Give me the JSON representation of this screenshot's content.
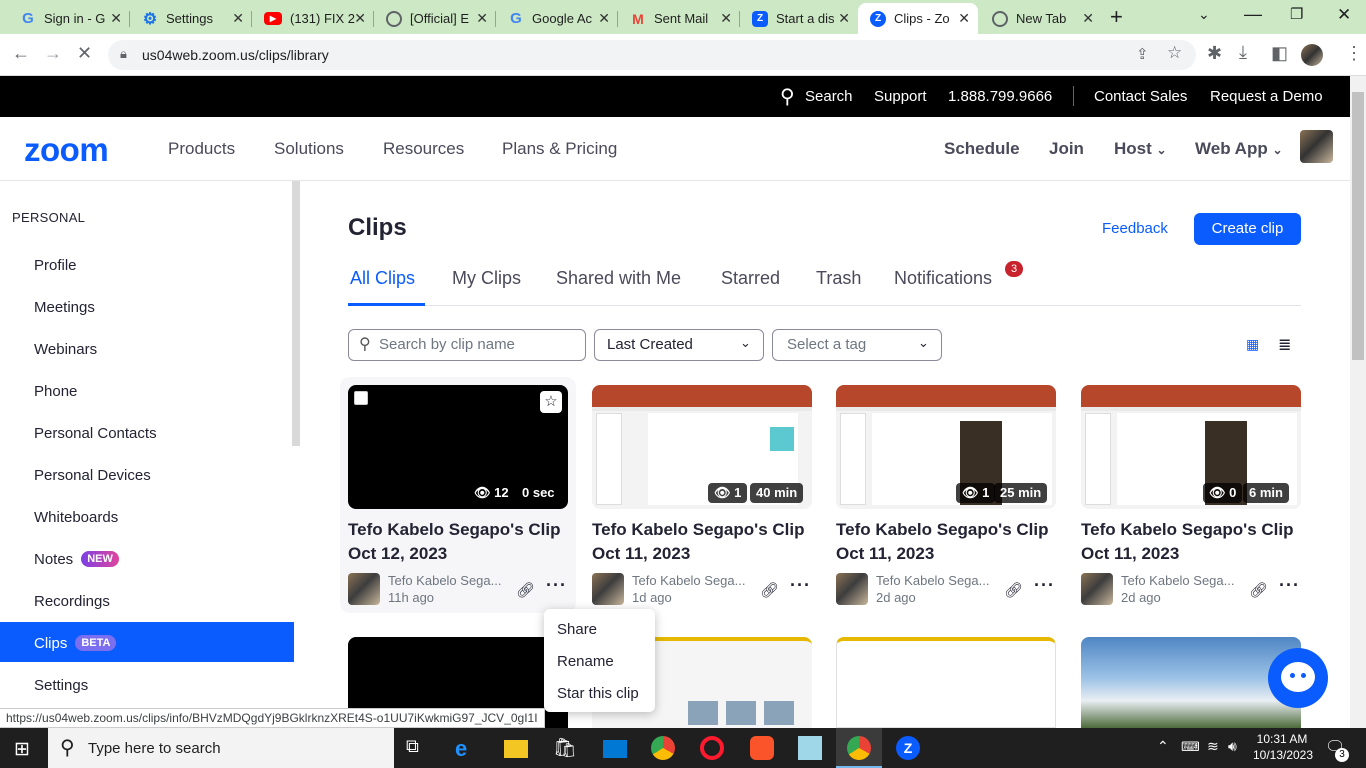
{
  "browser": {
    "tabs": [
      {
        "title": "Sign in - G",
        "icon": "google-icon",
        "color": "#4285f4"
      },
      {
        "title": "Settings",
        "icon": "gear-icon",
        "color": "#1a73e8"
      },
      {
        "title": "(131) FIX 2",
        "icon": "youtube-icon",
        "color": "#ff0000"
      },
      {
        "title": "[Official] E",
        "icon": "globe-icon",
        "color": "#5f6368"
      },
      {
        "title": "Google Ac",
        "icon": "google-icon",
        "color": "#4285f4"
      },
      {
        "title": "Sent Mail",
        "icon": "gmail-icon",
        "color": "#ea4335"
      },
      {
        "title": "Start a dis",
        "icon": "zoom-icon",
        "color": "#0b5cff"
      },
      {
        "title": "Clips - Zo",
        "icon": "zoom-clips-icon",
        "color": "#0b5cff"
      },
      {
        "title": "New Tab",
        "icon": "chrome-icon",
        "color": "#5f6368"
      }
    ],
    "url": "us04web.zoom.us/clips/library",
    "status_url": "https://us04web.zoom.us/clips/info/BHVzMDQgdYj9BGklrknzXREt4S-o1UU7iKwkmiG97_JCV_0gI1I"
  },
  "topbar": {
    "search": "Search",
    "support": "Support",
    "phone": "1.888.799.9666",
    "contact_sales": "Contact Sales",
    "request_demo": "Request a Demo"
  },
  "nav": {
    "logo": "zoom",
    "products": "Products",
    "solutions": "Solutions",
    "resources": "Resources",
    "plans": "Plans & Pricing",
    "schedule": "Schedule",
    "join": "Join",
    "host": "Host",
    "webapp": "Web App"
  },
  "sidebar": {
    "header": "PERSONAL",
    "items": [
      {
        "label": "Profile"
      },
      {
        "label": "Meetings"
      },
      {
        "label": "Webinars"
      },
      {
        "label": "Phone"
      },
      {
        "label": "Personal Contacts"
      },
      {
        "label": "Personal Devices"
      },
      {
        "label": "Whiteboards"
      },
      {
        "label": "Notes",
        "badge": "NEW"
      },
      {
        "label": "Recordings"
      },
      {
        "label": "Clips",
        "badge": "BETA"
      },
      {
        "label": "Settings"
      }
    ]
  },
  "clips": {
    "title": "Clips",
    "feedback": "Feedback",
    "create": "Create clip",
    "tabs": [
      "All Clips",
      "My Clips",
      "Shared with Me",
      "Starred",
      "Trash",
      "Notifications"
    ],
    "notifications_count": "3",
    "search_placeholder": "Search by clip name",
    "sort": "Last Created",
    "tag": "Select a tag",
    "cards": [
      {
        "title": "Tefo Kabelo Segapo's Clip Oct 12, 2023",
        "owner": "Tefo Kabelo Sega...",
        "age": "11h ago",
        "views": "12",
        "duration": "0 sec"
      },
      {
        "title": "Tefo Kabelo Segapo's Clip Oct 11, 2023",
        "owner": "Tefo Kabelo Sega...",
        "age": "1d ago",
        "views": "1",
        "duration": "40 min"
      },
      {
        "title": "Tefo Kabelo Segapo's Clip Oct 11, 2023",
        "owner": "Tefo Kabelo Sega...",
        "age": "2d ago",
        "views": "1",
        "duration": "25 min"
      },
      {
        "title": "Tefo Kabelo Segapo's Clip Oct 11, 2023",
        "owner": "Tefo Kabelo Sega...",
        "age": "2d ago",
        "views": "0",
        "duration": "6 min"
      }
    ],
    "menu": [
      "Share",
      "Rename",
      "Star this clip"
    ]
  },
  "taskbar": {
    "search": "Type here to search",
    "time": "10:31 AM",
    "date": "10/13/2023",
    "notif_count": "3"
  },
  "colors": {
    "accent": "#0b5cff",
    "tabstrip": "#cce8c4",
    "badge": "#c8232c"
  }
}
